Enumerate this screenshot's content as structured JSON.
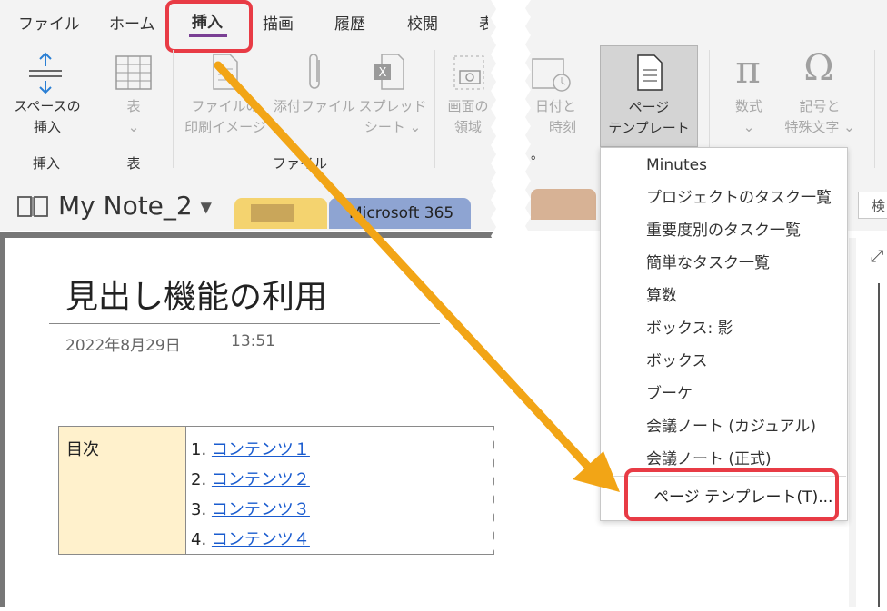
{
  "tabs": [
    "ファイル",
    "ホーム",
    "挿入",
    "描画",
    "履歴",
    "校閲",
    "表"
  ],
  "active_tab_underline_color": "#7a3f94",
  "highlight_color": "#e83b45",
  "arrow_color": "#f2a516",
  "ribbon": {
    "insert_space": {
      "line1": "スペースの",
      "line2": "挿入",
      "group": "挿入"
    },
    "table": {
      "label": "表",
      "group": "表"
    },
    "file_printout": {
      "line1": "ファイルの",
      "line2": "印刷イメージ"
    },
    "attach_file": {
      "line1": "添付ファイル"
    },
    "spreadsheet": {
      "line1": "スプレッド",
      "line2": "シート"
    },
    "file_group": "ファイル",
    "screen_clip": {
      "line1": "画面の",
      "line2": "領域"
    },
    "date_time": {
      "line1": "日付と",
      "line2": "時刻"
    },
    "page_template": {
      "line1": "ページ",
      "line2": "テンプレート"
    },
    "equation": {
      "line1": "数式"
    },
    "symbol": {
      "line1": "記号と",
      "line2": "特殊文字"
    },
    "trailing_dot": "。"
  },
  "notebook": {
    "name": "My Note_2",
    "sections": [
      "Microsoft 365"
    ],
    "search_placeholder": "検"
  },
  "page": {
    "title": "見出し機能の利用",
    "date": "2022年8月29日",
    "time": "13:51",
    "toc_heading": "目次",
    "toc_items": [
      {
        "num": "1.",
        "text": "コンテンツ１"
      },
      {
        "num": "2.",
        "text": "コンテンツ２"
      },
      {
        "num": "3.",
        "text": "コンテンツ３"
      },
      {
        "num": "4.",
        "text": "コンテンツ４"
      }
    ]
  },
  "template_menu": {
    "items": [
      "Minutes",
      "プロジェクトのタスク一覧",
      "重要度別のタスク一覧",
      "簡単なタスク一覧",
      "算数",
      "ボックス: 影",
      "ボックス",
      "ブーケ",
      "会議ノート (カジュアル)",
      "会議ノート (正式)"
    ],
    "last_item": "ページ テンプレート(T)..."
  }
}
